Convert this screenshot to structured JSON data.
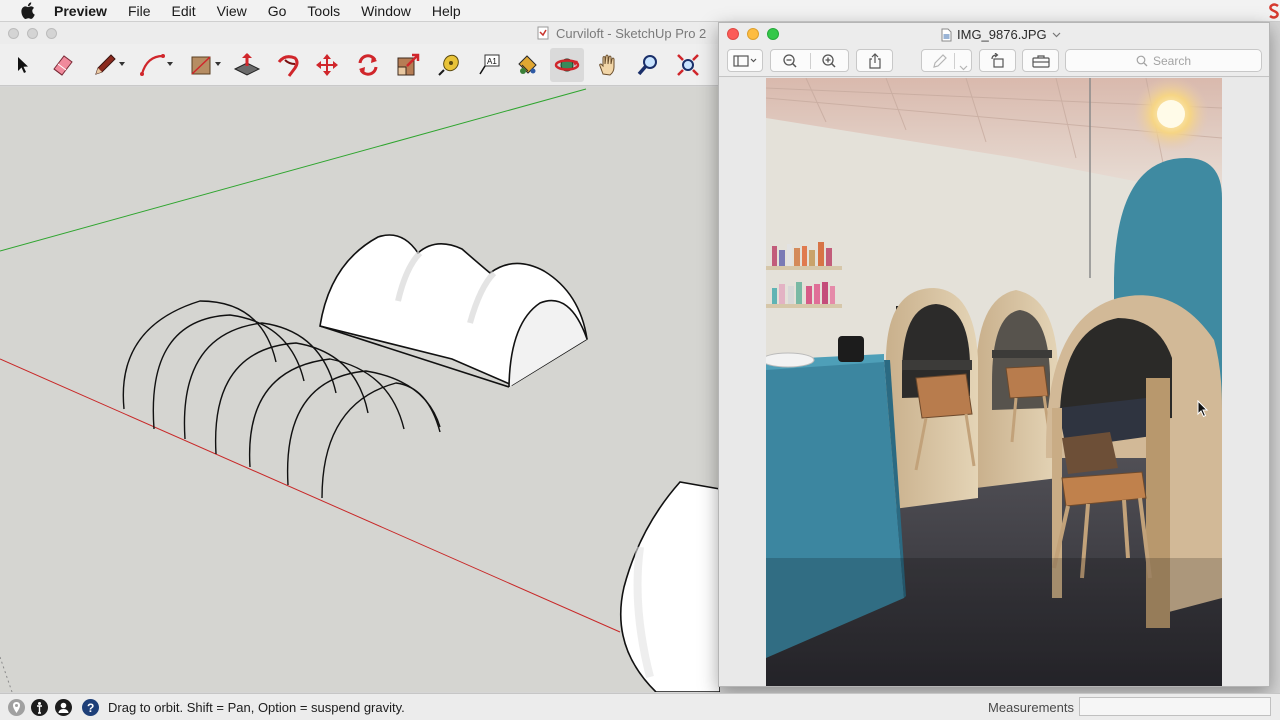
{
  "menubar": {
    "app_name": "Preview",
    "items": [
      "File",
      "Edit",
      "View",
      "Go",
      "Tools",
      "Window",
      "Help"
    ]
  },
  "sketchup": {
    "window_title": "Curviloft - SketchUp Pro 2",
    "tools": [
      {
        "icon": "select-arrow-icon"
      },
      {
        "icon": "eraser-icon"
      },
      {
        "icon": "pencil-line-icon"
      },
      {
        "icon": "arc-icon"
      },
      {
        "icon": "rectangle-shape-icon"
      },
      {
        "icon": "push-pull-icon"
      },
      {
        "icon": "follow-me-icon"
      },
      {
        "icon": "move-icon"
      },
      {
        "icon": "rotate-icon"
      },
      {
        "icon": "scale-icon"
      },
      {
        "icon": "tape-measure-icon"
      },
      {
        "icon": "text-icon"
      },
      {
        "icon": "paint-bucket-icon"
      },
      {
        "icon": "orbit-icon"
      },
      {
        "icon": "pan-hand-icon"
      },
      {
        "icon": "zoom-icon"
      },
      {
        "icon": "zoom-extents-icon"
      }
    ],
    "active_tool": "orbit-icon",
    "statusbar": {
      "message": "Drag to orbit. Shift = Pan, Option = suspend gravity.",
      "measurements_label": "Measurements",
      "measurements_value": ""
    },
    "colors": {
      "green_axis": "#2fa52f",
      "red_axis": "#c82828",
      "viewport_bg": "#d5d5d1"
    }
  },
  "preview": {
    "file_name": "IMG_9876.JPG",
    "search_placeholder": "Search",
    "toolbar_icons": [
      "sidebar-toggle-icon",
      "zoom-out-icon",
      "zoom-in-icon",
      "share-icon",
      "markup-pen-icon",
      "rotate-left-icon",
      "toolbox-icon"
    ]
  }
}
